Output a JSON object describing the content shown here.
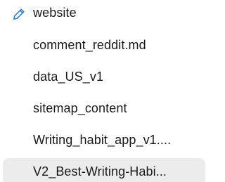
{
  "files": {
    "items": [
      {
        "label": "website",
        "icon": "pencil-icon",
        "selected": false
      },
      {
        "label": "comment_reddit.md",
        "selected": false
      },
      {
        "label": "data_US_v1",
        "selected": false
      },
      {
        "label": "sitemap_content",
        "selected": false
      },
      {
        "label": "Writing_habit_app_v1....",
        "selected": false
      },
      {
        "label": "V2_Best-Writing-Habi...",
        "selected": true
      }
    ]
  },
  "colors": {
    "icon": "#2f7de1",
    "selected_background": "#ececec",
    "text": "#1a1a1a"
  }
}
